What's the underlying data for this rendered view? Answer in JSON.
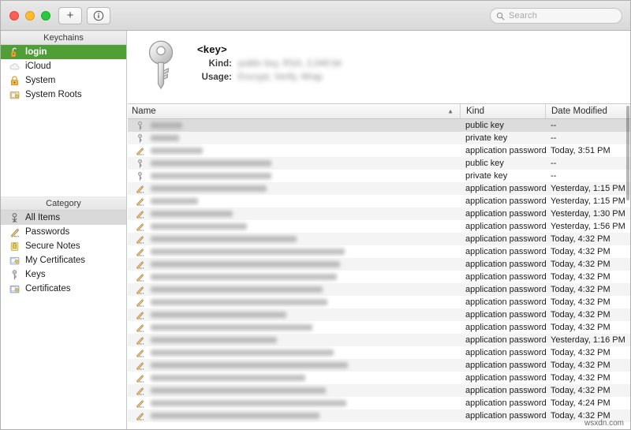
{
  "window": {
    "toolbar": {
      "add_label": "+",
      "info_label": "ⓘ",
      "traffic_lights": [
        "close",
        "minimize",
        "zoom"
      ]
    },
    "search": {
      "placeholder": "Search",
      "value": "",
      "icon": "search-icon"
    }
  },
  "sidebar": {
    "keychains_header": "Keychains",
    "keychains": [
      {
        "label": "login",
        "icon": "unlocked-padlock-icon",
        "selected": true
      },
      {
        "label": "iCloud",
        "icon": "cloud-icon",
        "selected": false
      },
      {
        "label": "System",
        "icon": "locked-padlock-icon",
        "selected": false
      },
      {
        "label": "System Roots",
        "icon": "certificate-folder-icon",
        "selected": false
      }
    ],
    "category_header": "Category",
    "categories": [
      {
        "label": "All Items",
        "icon": "keyring-icon",
        "selected": true
      },
      {
        "label": "Passwords",
        "icon": "pencil-key-icon",
        "selected": false
      },
      {
        "label": "Secure Notes",
        "icon": "yellow-note-icon",
        "selected": false
      },
      {
        "label": "My Certificates",
        "icon": "certificate-icon",
        "selected": false
      },
      {
        "label": "Keys",
        "icon": "key-icon",
        "selected": false
      },
      {
        "label": "Certificates",
        "icon": "certificate-icon",
        "selected": false
      }
    ]
  },
  "detail": {
    "icon": "large-key-icon",
    "title": "<key>",
    "fields": [
      {
        "label": "Kind:",
        "value": "public key, RSA, 2,048 bit"
      },
      {
        "label": "Usage:",
        "value": "Encrypt, Verify, Wrap"
      }
    ]
  },
  "table": {
    "columns": [
      {
        "key": "name",
        "label": "Name",
        "sort": "ascending"
      },
      {
        "key": "kind",
        "label": "Kind"
      },
      {
        "key": "date",
        "label": "Date Modified"
      }
    ],
    "rows": [
      {
        "icon": "key-icon",
        "name_width": 40,
        "kind": "public key",
        "date": "--",
        "selected": true
      },
      {
        "icon": "key-icon",
        "name_width": 36,
        "kind": "private key",
        "date": "--"
      },
      {
        "icon": "pencil-icon",
        "name_width": 66,
        "kind": "application password",
        "date": "Today, 3:51 PM"
      },
      {
        "icon": "key-icon",
        "name_width": 153,
        "kind": "public key",
        "date": "--"
      },
      {
        "icon": "key-icon",
        "name_width": 153,
        "kind": "private key",
        "date": "--"
      },
      {
        "icon": "pencil-icon",
        "name_width": 147,
        "kind": "application password",
        "date": "Yesterday, 1:15 PM"
      },
      {
        "icon": "pencil-icon",
        "name_width": 60,
        "kind": "application password",
        "date": "Yesterday, 1:15 PM"
      },
      {
        "icon": "pencil-icon",
        "name_width": 104,
        "kind": "application password",
        "date": "Yesterday, 1:30 PM"
      },
      {
        "icon": "pencil-icon",
        "name_width": 122,
        "kind": "application password",
        "date": "Yesterday, 1:56 PM"
      },
      {
        "icon": "pencil-icon",
        "name_width": 185,
        "kind": "application password",
        "date": "Today, 4:32 PM"
      },
      {
        "icon": "pencil-icon",
        "name_width": 246,
        "kind": "application password",
        "date": "Today, 4:32 PM"
      },
      {
        "icon": "pencil-icon",
        "name_width": 240,
        "kind": "application password",
        "date": "Today, 4:32 PM"
      },
      {
        "icon": "pencil-icon",
        "name_width": 236,
        "kind": "application password",
        "date": "Today, 4:32 PM"
      },
      {
        "icon": "pencil-icon",
        "name_width": 218,
        "kind": "application password",
        "date": "Today, 4:32 PM"
      },
      {
        "icon": "pencil-icon",
        "name_width": 224,
        "kind": "application password",
        "date": "Today, 4:32 PM"
      },
      {
        "icon": "pencil-icon",
        "name_width": 172,
        "kind": "application password",
        "date": "Today, 4:32 PM"
      },
      {
        "icon": "pencil-icon",
        "name_width": 205,
        "kind": "application password",
        "date": "Today, 4:32 PM"
      },
      {
        "icon": "pencil-icon",
        "name_width": 160,
        "kind": "application password",
        "date": "Yesterday, 1:16 PM"
      },
      {
        "icon": "pencil-icon",
        "name_width": 232,
        "kind": "application password",
        "date": "Today, 4:32 PM"
      },
      {
        "icon": "pencil-icon",
        "name_width": 250,
        "kind": "application password",
        "date": "Today, 4:32 PM"
      },
      {
        "icon": "pencil-icon",
        "name_width": 196,
        "kind": "application password",
        "date": "Today, 4:32 PM"
      },
      {
        "icon": "pencil-icon",
        "name_width": 222,
        "kind": "application password",
        "date": "Today, 4:32 PM"
      },
      {
        "icon": "pencil-icon",
        "name_width": 248,
        "kind": "application password",
        "date": "Today, 4:24 PM"
      },
      {
        "icon": "pencil-icon",
        "name_width": 214,
        "kind": "application password",
        "date": "Today, 4:32 PM"
      }
    ]
  },
  "watermark": "wsxdn.com",
  "colors": {
    "selection_green": "#4f9e36",
    "row_stripe": "#f4f4f4",
    "selected_row": "#dcdcdc"
  }
}
